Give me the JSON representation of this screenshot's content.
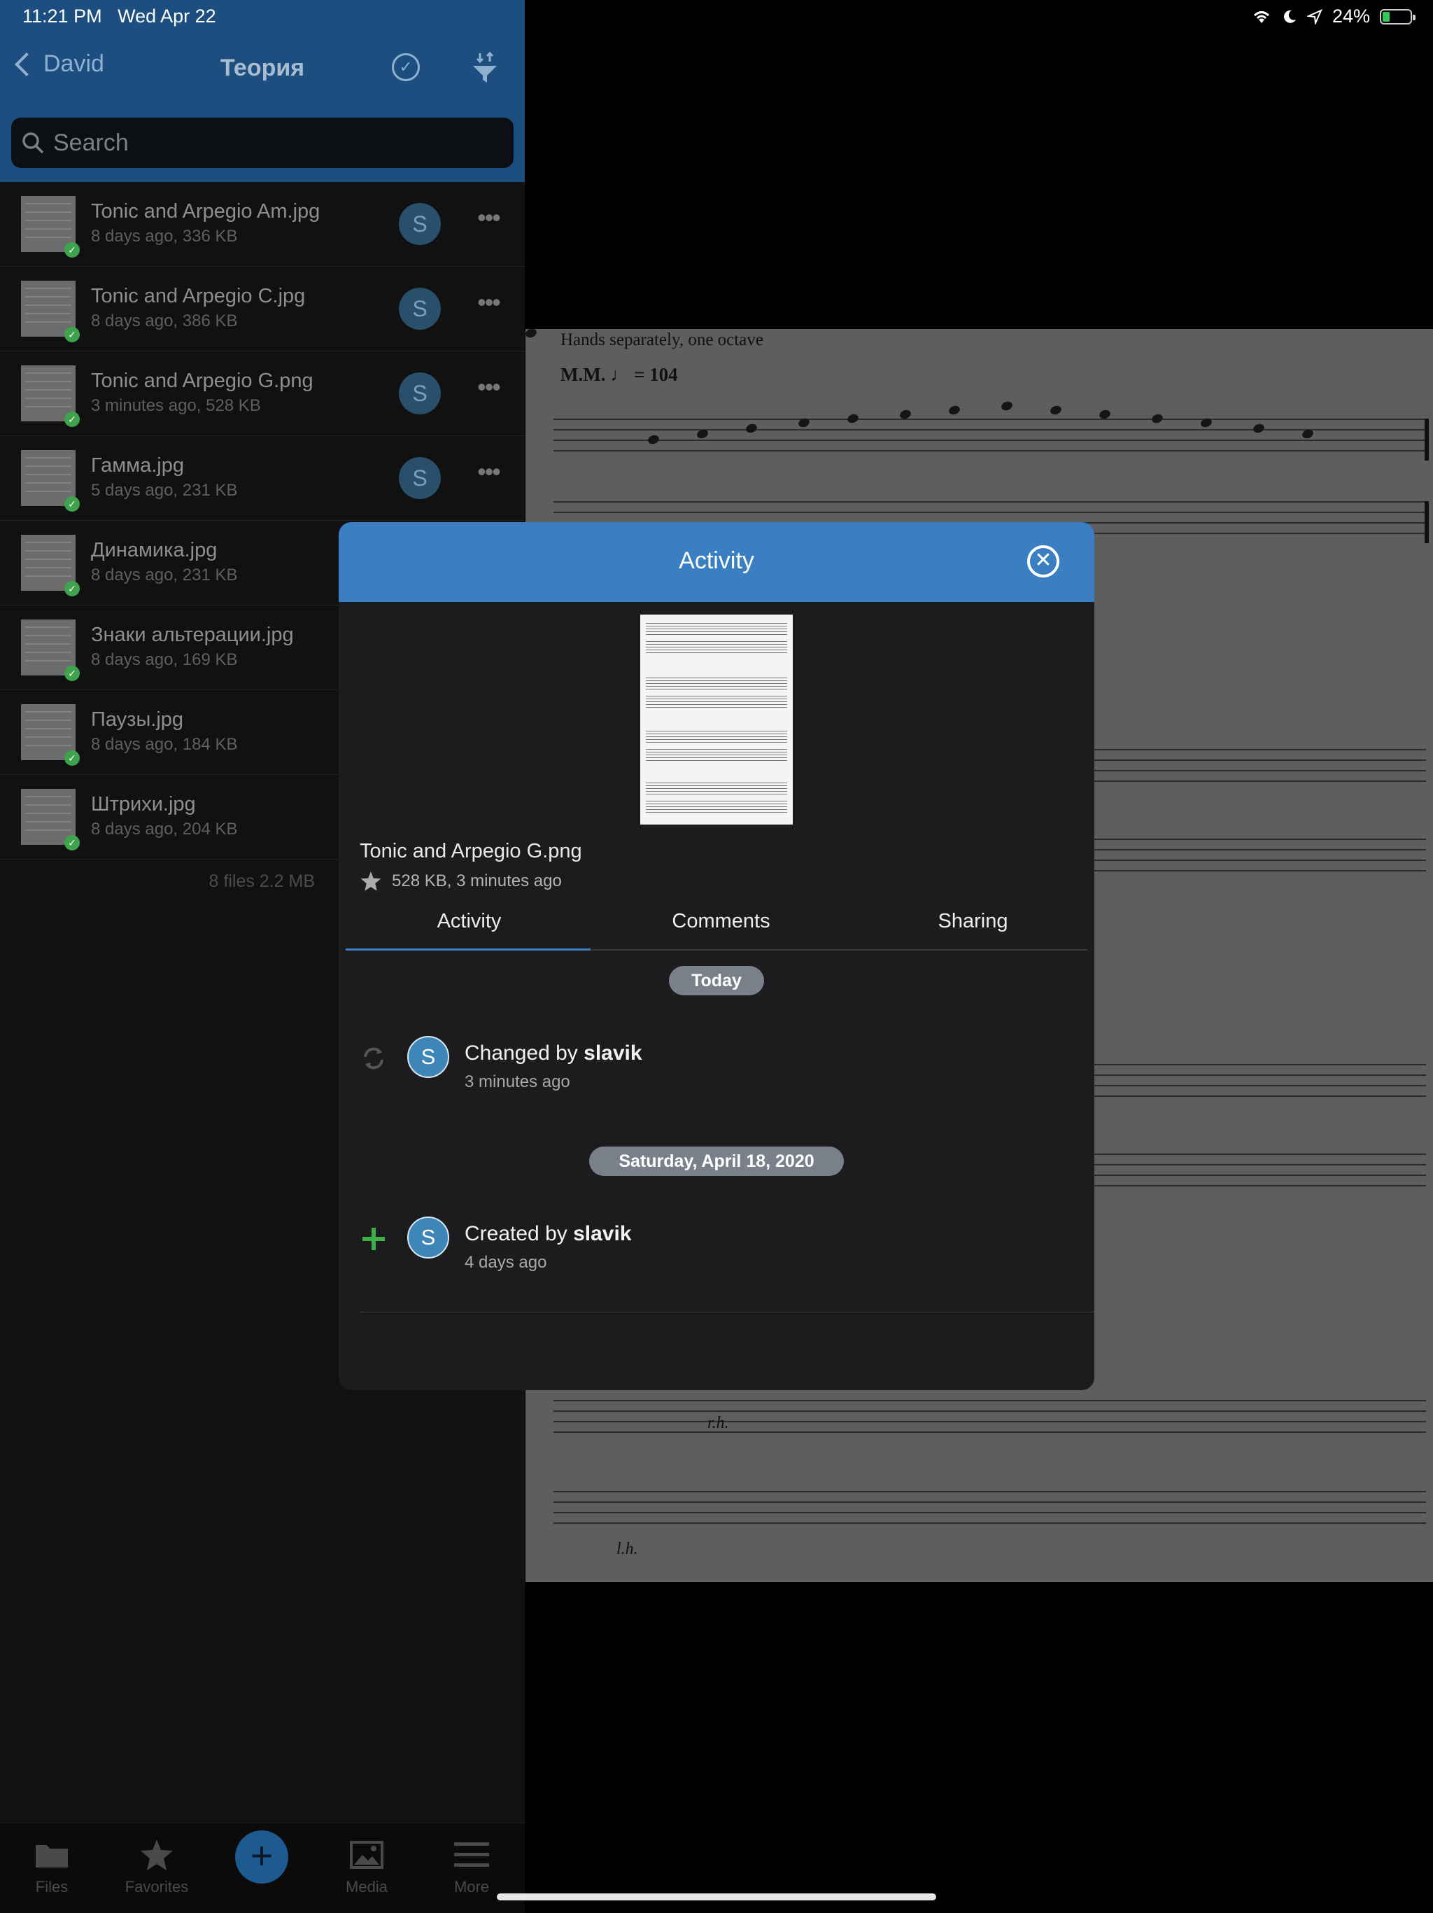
{
  "status_bar": {
    "time": "11:21 PM",
    "date": "Wed Apr 22",
    "battery": "24%"
  },
  "header": {
    "back_label": "David",
    "title": "Теория"
  },
  "search": {
    "placeholder": "Search"
  },
  "files": [
    {
      "name": "Tonic and Arpegio Am.jpg",
      "meta": "8 days ago, 336 KB",
      "avatar": "S"
    },
    {
      "name": "Tonic and Arpegio C.jpg",
      "meta": "8 days ago, 386 KB",
      "avatar": "S"
    },
    {
      "name": "Tonic and Arpegio G.png",
      "meta": "3 minutes ago, 528 KB",
      "avatar": "S"
    },
    {
      "name": "Гамма.jpg",
      "meta": "5 days ago, 231 KB",
      "avatar": "S"
    },
    {
      "name": "Динамика.jpg",
      "meta": "8 days ago, 231 KB"
    },
    {
      "name": "Знаки альтерации.jpg",
      "meta": "8 days ago, 169 KB"
    },
    {
      "name": "Паузы.jpg",
      "meta": "8 days ago, 184 KB"
    },
    {
      "name": "Штрихи.jpg",
      "meta": "8 days ago, 204 KB"
    }
  ],
  "files_summary": "8 files 2.2 MB",
  "tab_bar": {
    "files": "Files",
    "favorites": "Favorites",
    "media": "Media",
    "more": "More"
  },
  "viewer": {
    "heading": "Hands separately, one octave",
    "tempo_prefix": "M.M.",
    "tempo_value": "= 104",
    "lh": "l.h.",
    "rh": "r.h."
  },
  "modal": {
    "title": "Activity",
    "file_name": "Tonic and Arpegio G.png",
    "file_info": "528 KB, 3 minutes ago",
    "tabs": [
      "Activity",
      "Comments",
      "Sharing"
    ],
    "groups": [
      {
        "date": "Today",
        "entries": [
          {
            "action": "Changed by",
            "user": "slavik",
            "time": "3 minutes ago",
            "avatar": "S",
            "icon": "sync-icon"
          }
        ]
      },
      {
        "date": "Saturday, April 18, 2020",
        "entries": [
          {
            "action": "Created by",
            "user": "slavik",
            "time": "4 days ago",
            "avatar": "S",
            "icon": "plus-icon"
          }
        ]
      }
    ]
  },
  "colors": {
    "header_bg": "#1c4f80",
    "modal_header": "#3a7fc2",
    "check_green": "#3fa34d",
    "plus_green": "#3fae49"
  }
}
